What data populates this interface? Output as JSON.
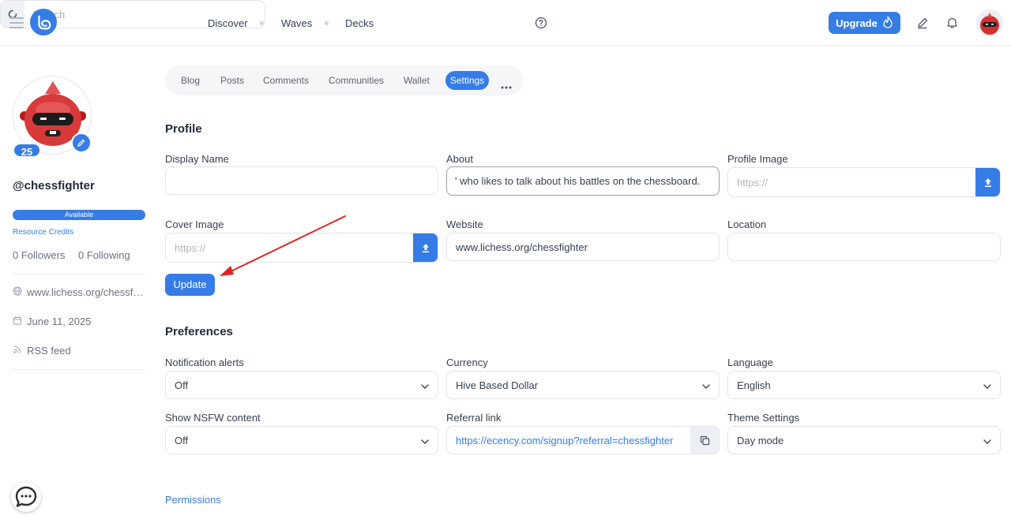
{
  "nav": {
    "links": [
      "Discover",
      "Waves",
      "Decks"
    ],
    "search_placeholder": "Search",
    "upgrade_label": "Upgrade"
  },
  "sidebar": {
    "reputation": "25",
    "username": "@chessfighter",
    "rc_status": "Available",
    "rc_link": "Resource Credits",
    "followers": "0 Followers",
    "following": "0 Following",
    "website": "www.lichess.org/chessfighter",
    "joined": "June 11, 2025",
    "rss": "RSS feed"
  },
  "tabs": {
    "items": [
      "Blog",
      "Posts",
      "Comments",
      "Communities",
      "Wallet"
    ],
    "active": "Settings"
  },
  "profile": {
    "title": "Profile",
    "display_name_label": "Display Name",
    "display_name_value": "",
    "about_label": "About",
    "about_value": "' who likes to talk about his battles on the chessboard.",
    "profile_image_label": "Profile Image",
    "profile_image_placeholder": "https://",
    "cover_image_label": "Cover Image",
    "cover_image_placeholder": "https://",
    "website_label": "Website",
    "website_value": "www.lichess.org/chessfighter",
    "location_label": "Location",
    "location_value": "",
    "update_label": "Update"
  },
  "preferences": {
    "title": "Preferences",
    "notification_label": "Notification alerts",
    "notification_value": "Off",
    "currency_label": "Currency",
    "currency_value": "Hive Based Dollar",
    "language_label": "Language",
    "language_value": "English",
    "nsfw_label": "Show NSFW content",
    "nsfw_value": "Off",
    "referral_label": "Referral link",
    "referral_value": "https://ecency.com/signup?referral=chessfighter",
    "theme_label": "Theme Settings",
    "theme_value": "Day mode"
  },
  "permissions_link": "Permissions",
  "colors": {
    "accent": "#357ce6",
    "annotation_arrow": "#e02424"
  },
  "icons": [
    "menu-icon",
    "ecency-logo-icon",
    "help-icon",
    "refresh-icon",
    "flame-icon",
    "pencil-icon",
    "bell-icon",
    "edit-icon",
    "globe-icon",
    "calendar-icon",
    "rss-icon",
    "upload-icon",
    "chevron-down-icon",
    "copy-icon",
    "chat-icon",
    "more-icon"
  ]
}
